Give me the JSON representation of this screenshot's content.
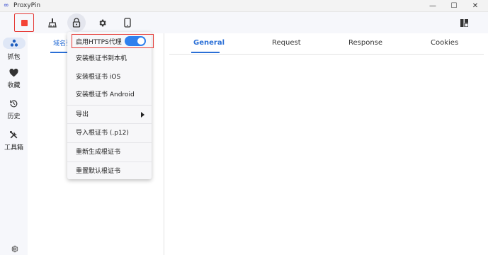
{
  "titlebar": {
    "logo": "∞",
    "title": "ProxyPin",
    "minimize": "—",
    "maximize": "☐",
    "close": "✕"
  },
  "toolbar": {
    "icons": [
      "stop-icon",
      "broom-icon",
      "lock-icon",
      "gear-icon",
      "phone-icon",
      "layout-icon"
    ],
    "accent": "#e53935"
  },
  "rail": {
    "items": [
      {
        "label": "抓包",
        "icon": "capture-icon"
      },
      {
        "label": "收藏",
        "icon": "heart-icon"
      },
      {
        "label": "历史",
        "icon": "history-icon"
      },
      {
        "label": "工具箱",
        "icon": "tools-icon"
      }
    ],
    "bottom_icon": "settings-icon"
  },
  "list_panel": {
    "tab_label": "域名列"
  },
  "detail": {
    "tabs": [
      "General",
      "Request",
      "Response",
      "Cookies"
    ],
    "active_tab": "General"
  },
  "menu": {
    "https_label": "启用HTTPS代理",
    "https_enabled": true,
    "items": [
      "安装根证书到本机",
      "安装根证书 iOS",
      "安装根证书 Android",
      "导出",
      "导入根证书 (.p12)",
      "重新生成根证书",
      "重置默认根证书"
    ]
  },
  "colors": {
    "accent_blue": "#2a6fd6",
    "toggle_blue": "#2f80ed",
    "highlight_red": "#e53935"
  }
}
